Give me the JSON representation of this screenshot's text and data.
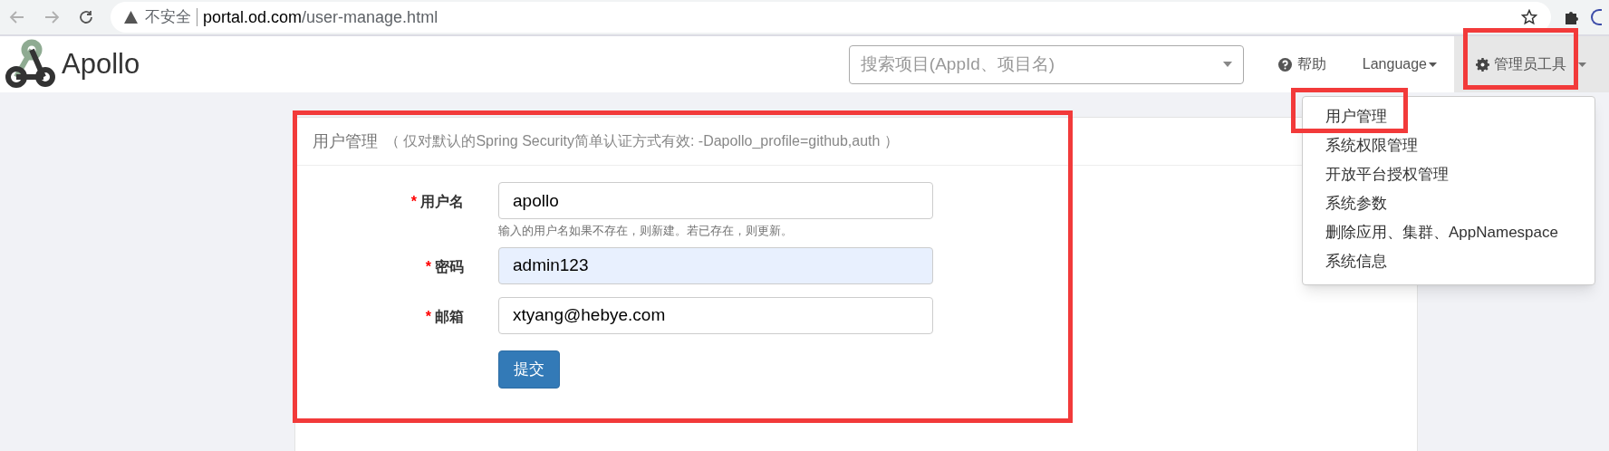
{
  "browser": {
    "security": "不安全",
    "host": "portal.od.com",
    "path": "/user-manage.html"
  },
  "navbar": {
    "brand": "Apollo",
    "search": {
      "placeholder": "搜索项目(AppId、项目名)"
    },
    "help": "帮助",
    "language": "Language",
    "admin": {
      "label": "管理员工具",
      "expanded": true
    }
  },
  "admin_menu": [
    "用户管理",
    "系统权限管理",
    "开放平台授权管理",
    "系统参数",
    "删除应用、集群、AppNamespace",
    "系统信息"
  ],
  "panel": {
    "title": "用户管理",
    "note": "（ 仅对默认的Spring Security简单认证方式有效: -Dapollo_profile=github,auth ）",
    "fields": [
      {
        "label": "用户名",
        "required_mark": "*",
        "value": "apollo",
        "autofilled": false,
        "help": "输入的用户名如果不存在，则新建。若已存在，则更新。"
      },
      {
        "label": "密码",
        "required_mark": "*",
        "value": "admin123",
        "autofilled": true
      },
      {
        "label": "邮箱",
        "required_mark": "*",
        "value": "xtyang@hebye.com",
        "autofilled": false
      }
    ],
    "submit": "提交"
  }
}
